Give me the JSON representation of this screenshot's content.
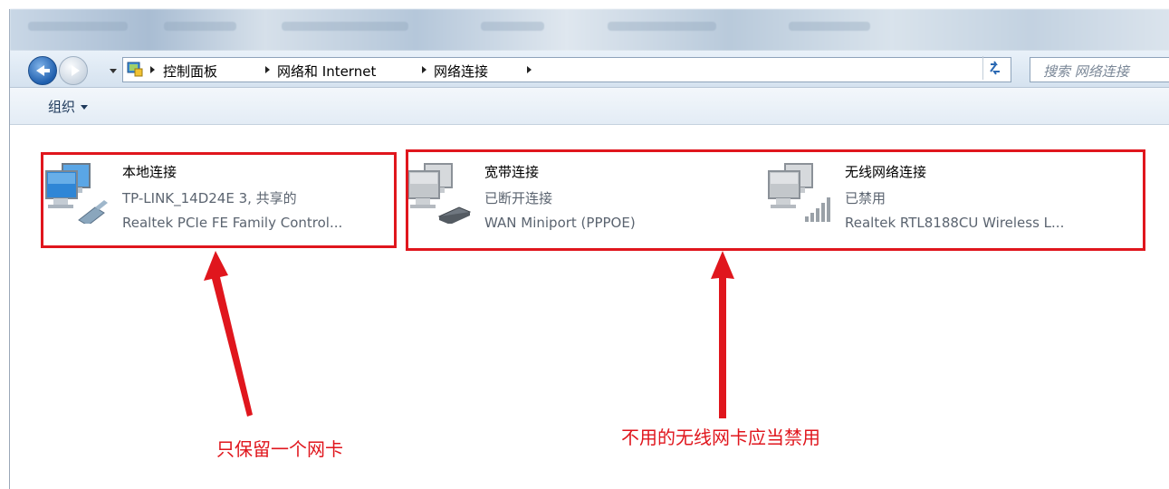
{
  "address_bar": {
    "breadcrumbs": [
      "控制面板",
      "网络和 Internet",
      "网络连接"
    ],
    "search_placeholder": "搜索 网络连接"
  },
  "toolbar": {
    "organize_label": "组织"
  },
  "connections": [
    {
      "name": "本地连接",
      "status": "TP-LINK_14D24E  3, 共享的",
      "device": "Realtek PCIe FE Family Control...",
      "icon": "lan-connection-icon",
      "state": "connected"
    },
    {
      "name": "宽带连接",
      "status": "已断开连接",
      "device": "WAN Miniport (PPPOE)",
      "icon": "broadband-connection-icon",
      "state": "disconnected"
    },
    {
      "name": "无线网络连接",
      "status": "已禁用",
      "device": "Realtek RTL8188CU Wireless L...",
      "icon": "wireless-connection-icon",
      "state": "disabled"
    }
  ],
  "annotations": {
    "left_note": "只保留一个网卡",
    "right_note": "不用的无线网卡应当禁用",
    "color": "#e0161d"
  },
  "colors": {
    "accent": "#1f5fae",
    "annotation_red": "#e0161d"
  }
}
